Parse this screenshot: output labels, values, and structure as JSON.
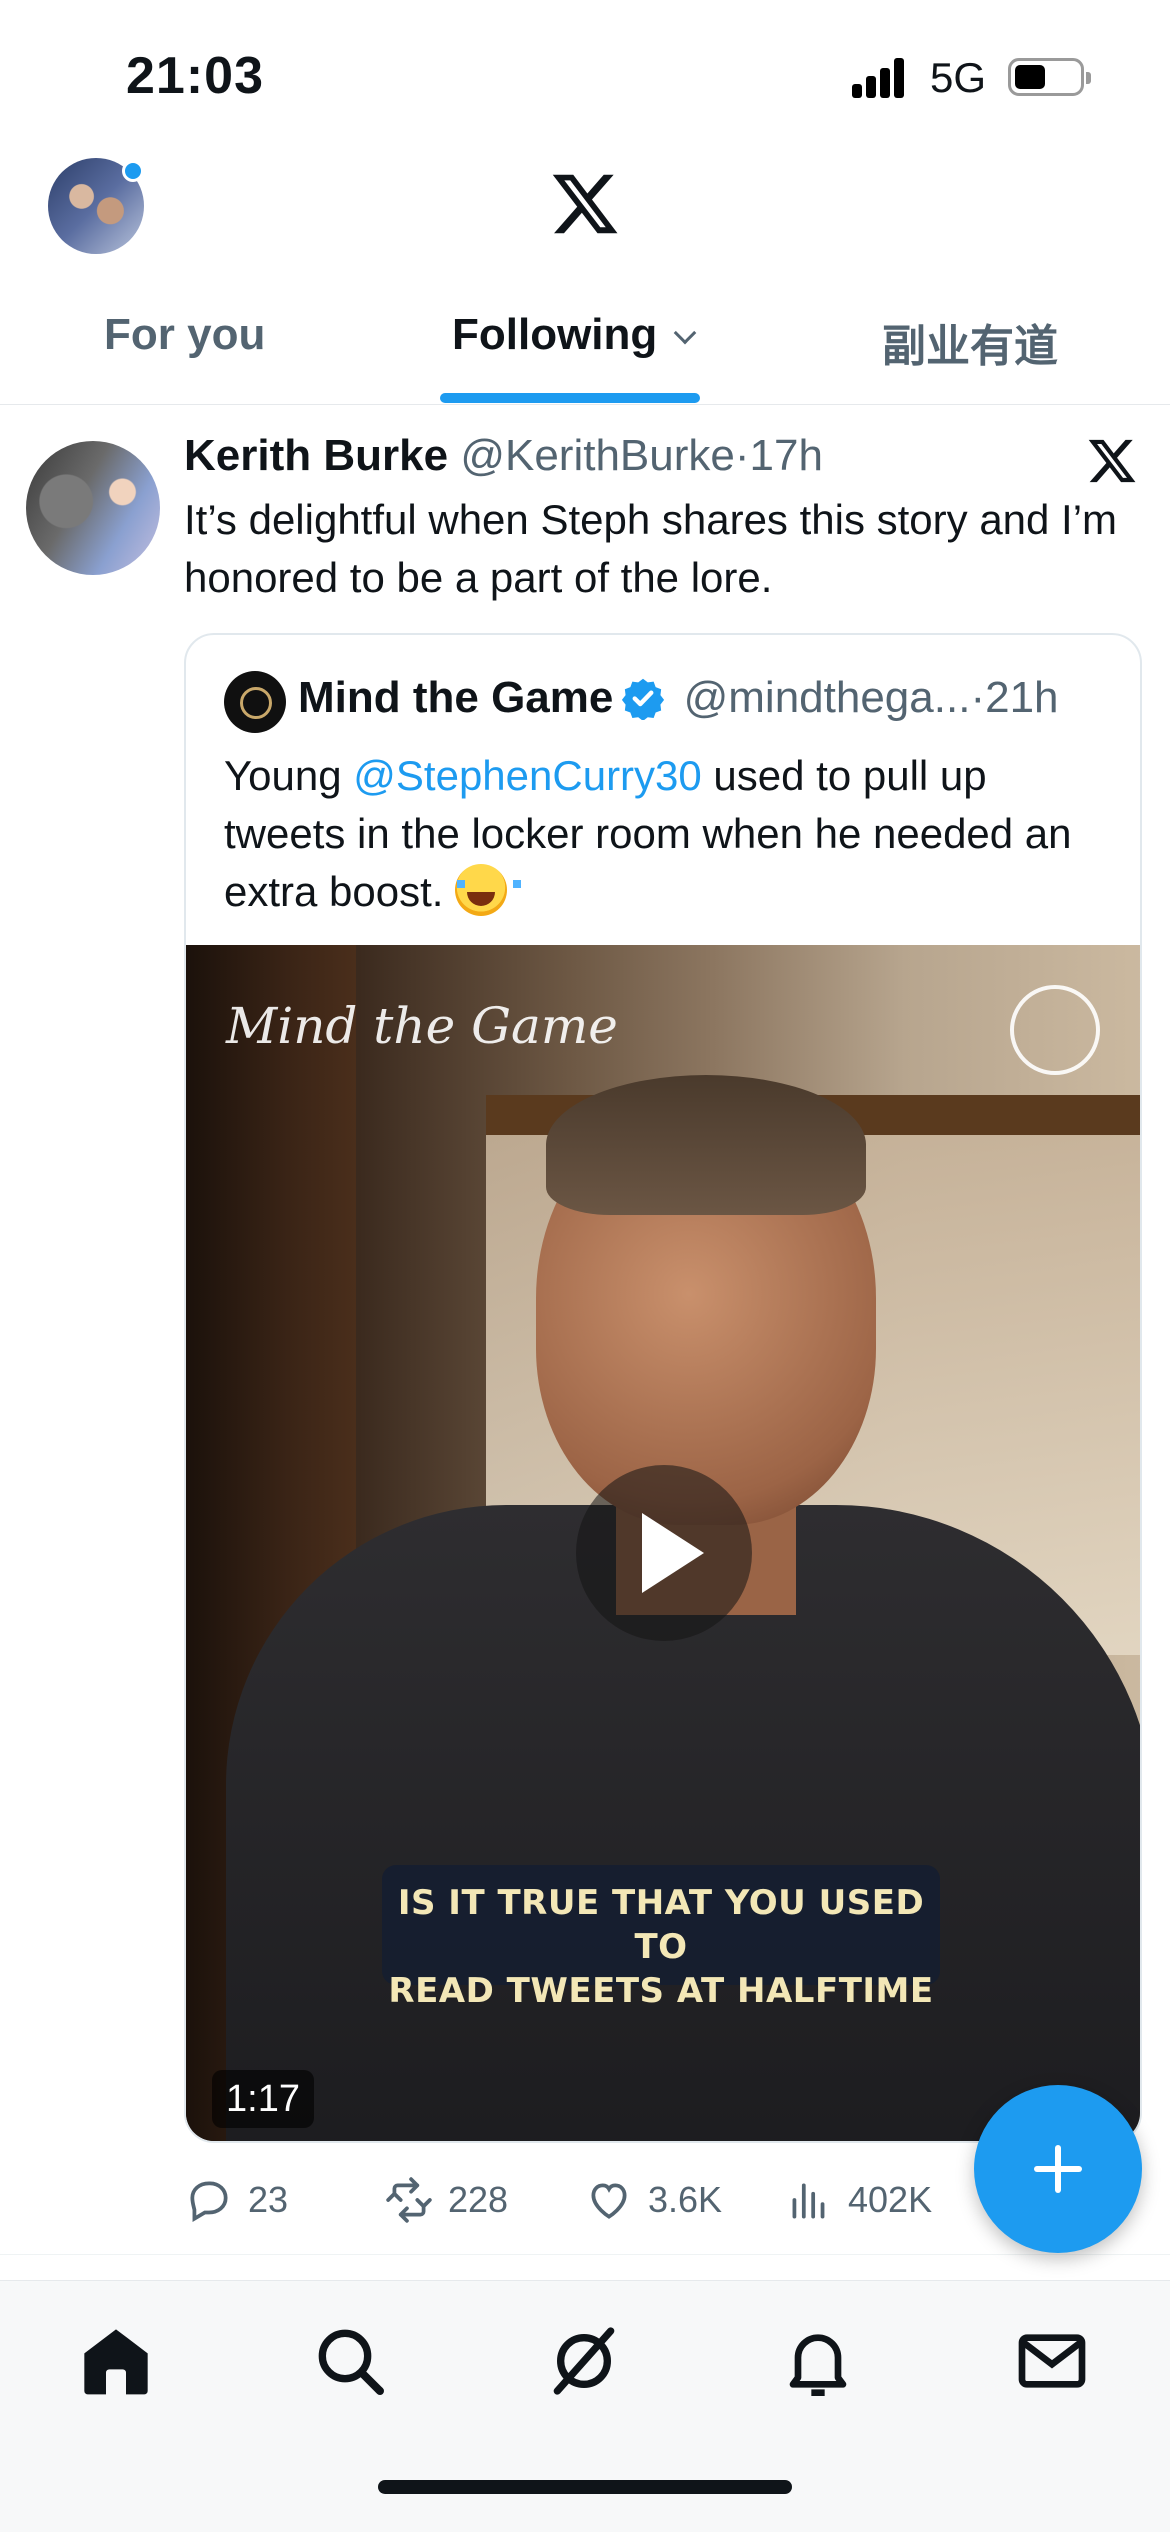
{
  "status_bar": {
    "time": "21:03",
    "network": "5G"
  },
  "tabs": [
    {
      "label": "For you"
    },
    {
      "label": "Following"
    },
    {
      "label": "副业有道"
    }
  ],
  "tweet": {
    "author": "Kerith Burke",
    "handle": "@KerithBurke",
    "separator": "·",
    "time": "17h",
    "text": "It’s delightful when Steph shares this story and I’m honored to be a part of the lore.",
    "quote": {
      "author": "Mind the Game",
      "handle": "@mindthega...",
      "separator": "·",
      "time": "21h",
      "text_before": "Young ",
      "mention": "@StephenCurry30",
      "text_after": " used to pull up tweets in the locker room when he needed an extra boost. ",
      "video": {
        "brand_overlay": "Mind the Game",
        "caption_line1": "IS IT TRUE THAT YOU USED TO",
        "caption_line2": "READ TWEETS AT HALFTIME",
        "duration": "1:17"
      }
    },
    "actions": {
      "replies": "23",
      "reposts": "228",
      "likes": "3.6K",
      "views": "402K"
    }
  },
  "colors": {
    "accent": "#1d9bf0",
    "text_primary": "#0f1419",
    "text_secondary": "#536471"
  }
}
